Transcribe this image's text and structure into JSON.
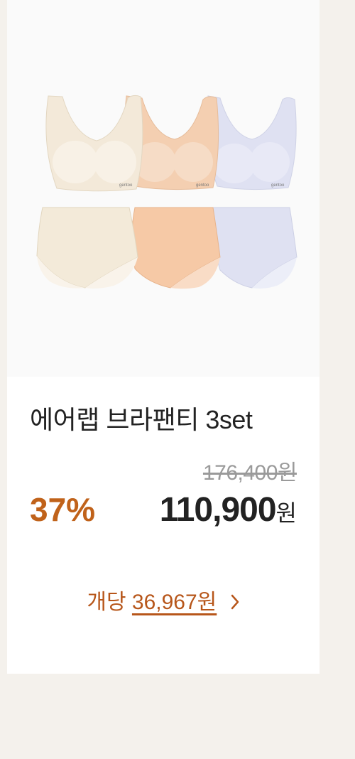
{
  "product": {
    "title": "에어랩 브라팬티 3set",
    "original_price": "176,400원",
    "discount_rate": "37%",
    "sale_price": "110,900",
    "currency": "원",
    "unit_price_label": "개당",
    "unit_price_value": "36,967원",
    "image_brand_text": "gentoo"
  },
  "colors": {
    "accent": "#c0621a",
    "swatches": [
      "#f3e9d9",
      "#f6c9a6",
      "#dfe1f2"
    ]
  }
}
